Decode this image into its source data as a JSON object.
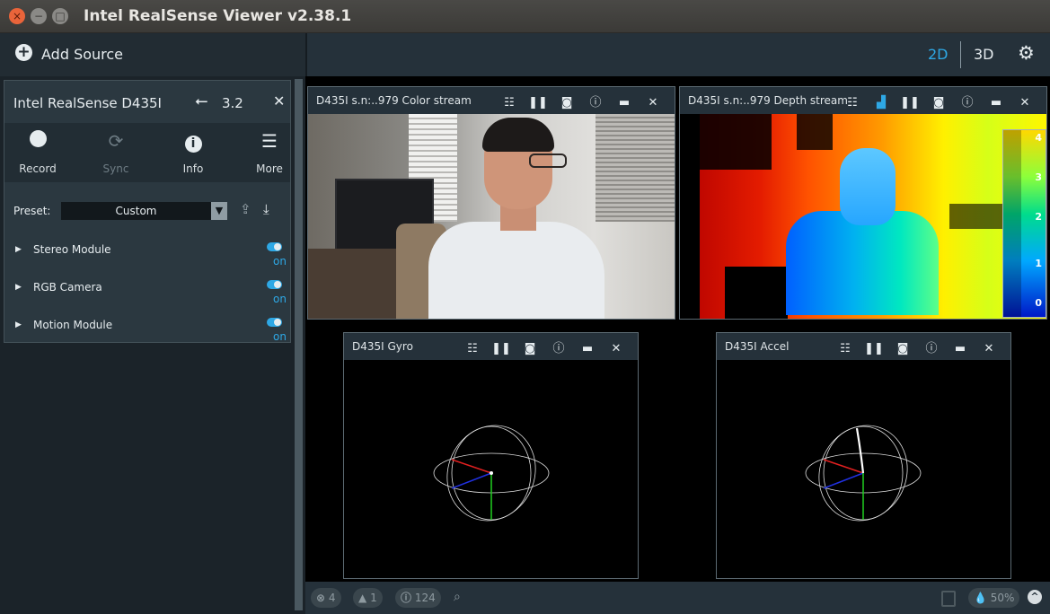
{
  "window": {
    "title": "Intel RealSense Viewer v2.38.1",
    "close_glyph": "×",
    "min_glyph": "−",
    "max_glyph": "□"
  },
  "toolbar": {
    "add_source_label": "Add Source",
    "view_2d": "2D",
    "view_3d": "3D",
    "accent": "#2ea8e5"
  },
  "device": {
    "name": "Intel RealSense D435I",
    "usb_version": "3.2",
    "buttons": [
      {
        "label": "Record",
        "icon": "record-circle-icon"
      },
      {
        "label": "Sync",
        "icon": "sync-icon"
      },
      {
        "label": "Info",
        "icon": "info-icon"
      },
      {
        "label": "More",
        "icon": "hamburger-menu-icon"
      }
    ],
    "preset_label": "Preset:",
    "preset_value": "Custom",
    "modules": [
      {
        "name": "Stereo Module",
        "state": "on"
      },
      {
        "name": "RGB Camera",
        "state": "on"
      },
      {
        "name": "Motion Module",
        "state": "on"
      }
    ]
  },
  "views": {
    "color": {
      "title": "D435I s.n:..979 Color stream"
    },
    "depth": {
      "title": "D435I s.n:..979 Depth stream",
      "scale_ticks": [
        "4",
        "3",
        "2",
        "1",
        "0"
      ]
    },
    "gyro": {
      "title": "D435I Gyro"
    },
    "accel": {
      "title": "D435I Accel"
    }
  },
  "status": {
    "errors": "4",
    "warnings": "1",
    "info": "124",
    "opacity": "50%"
  }
}
